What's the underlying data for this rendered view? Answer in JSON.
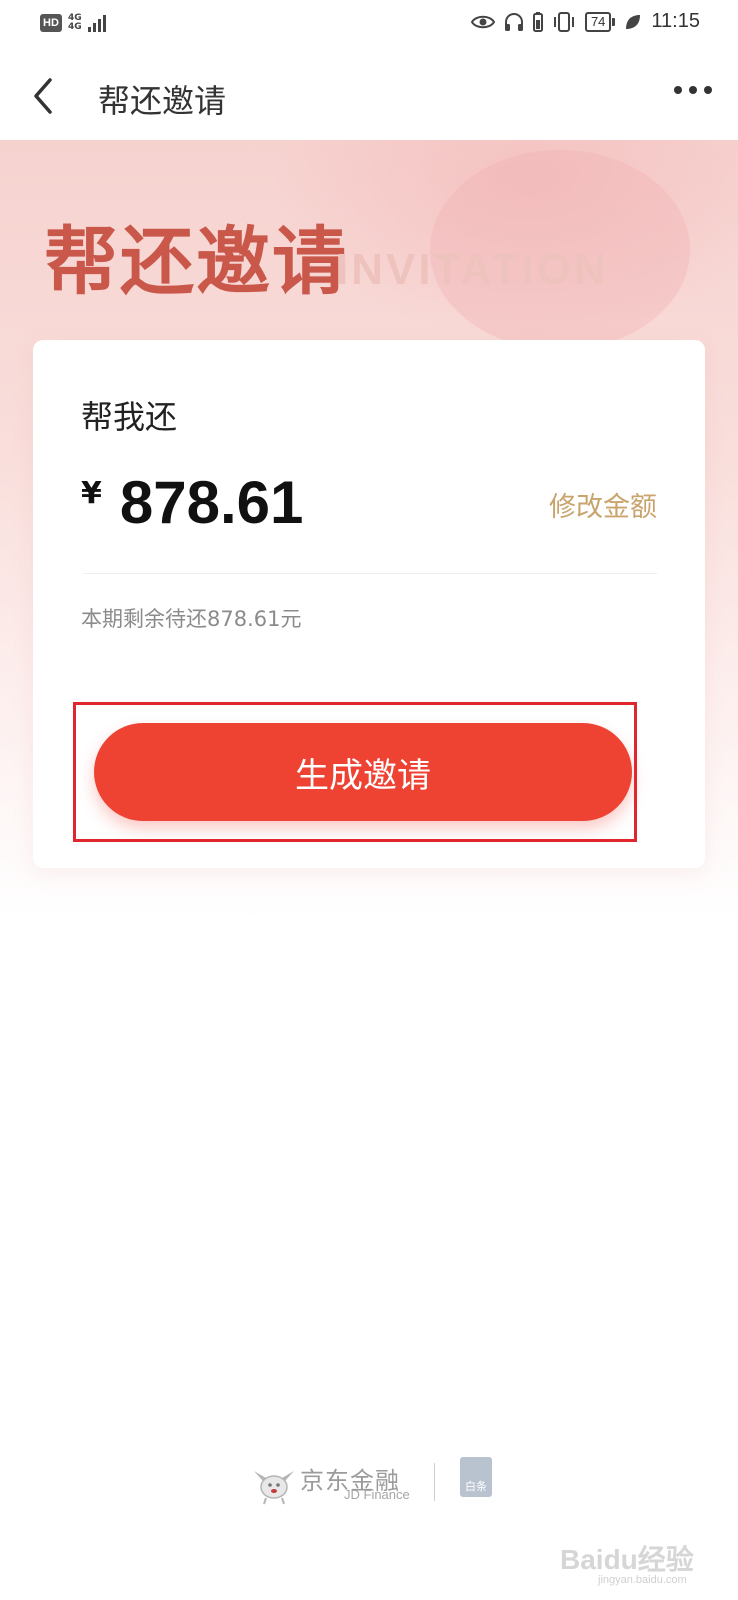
{
  "status_bar": {
    "hd": "HD",
    "network": [
      "4G",
      "4G"
    ],
    "battery": "74",
    "time": "11:15"
  },
  "nav": {
    "title": "帮还邀请",
    "back_icon": "chevron-left-icon",
    "more_icon": "more-dots-icon"
  },
  "hero": {
    "title": "帮还邀请",
    "subtitle_en": "INVITATION"
  },
  "card": {
    "title": "帮我还",
    "currency": "¥",
    "amount": "878.61",
    "modify_label": "修改金额",
    "remaining": "本期剩余待还878.61元",
    "button_label": "生成邀请"
  },
  "footer": {
    "brand_cn": "京东金融",
    "brand_en": "JD Finance",
    "baitiao": "白条"
  },
  "watermark": {
    "text": "Baidu经验",
    "url": "jingyan.baidu.com"
  },
  "colors": {
    "accent": "#ee4233",
    "hero_title": "#c9584b",
    "modify": "#c9a46c",
    "highlight_border": "#e0262f"
  }
}
